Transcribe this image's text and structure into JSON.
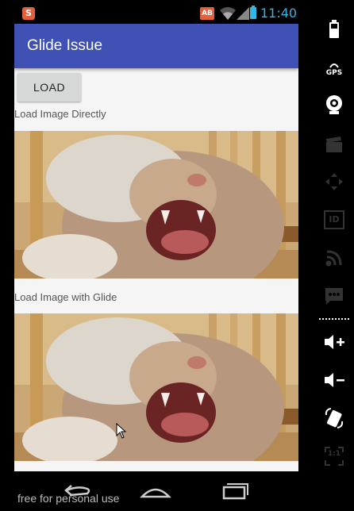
{
  "status_bar": {
    "app_notification_letter": "S",
    "badge": "AB",
    "time": "11:40"
  },
  "app": {
    "title": "Glide Issue",
    "load_button": "LOAD",
    "label_direct": "Load Image Directly",
    "label_glide": "Load Image with Glide"
  },
  "nav": {
    "watermark": "free for personal use"
  },
  "side_panel": {
    "gps_label": "GPS",
    "id_label": "ID",
    "ratio_label": "1:1"
  },
  "colors": {
    "primary": "#3f51b5",
    "clock": "#33b5e5",
    "badge": "#e0613b"
  }
}
